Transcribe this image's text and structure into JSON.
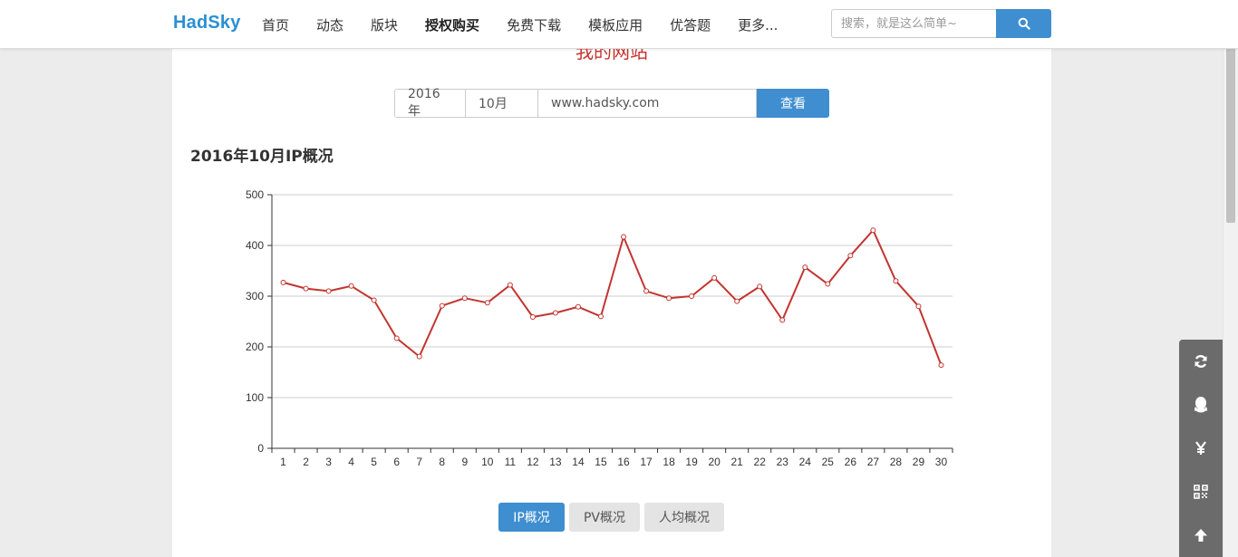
{
  "header": {
    "brand": "HadSky",
    "nav": [
      {
        "label": "首页"
      },
      {
        "label": "动态"
      },
      {
        "label": "版块"
      },
      {
        "label": "授权购买",
        "active": true
      },
      {
        "label": "免费下载"
      },
      {
        "label": "模板应用"
      },
      {
        "label": "优答题"
      },
      {
        "label": "更多..."
      }
    ],
    "search": {
      "placeholder": "搜索，就是这么简单~",
      "button_icon": "search-icon"
    }
  },
  "page": {
    "site_title": "我的网站",
    "filter": {
      "year": "2016年",
      "month": "10月",
      "domain": "www.hadsky.com",
      "query_label": "查看"
    },
    "section_title": "2016年10月IP概况",
    "tabs": [
      {
        "label": "IP概况",
        "active": true
      },
      {
        "label": "PV概况",
        "active": false
      },
      {
        "label": "人均概况",
        "active": false
      }
    ]
  },
  "float_toolbar": [
    "refresh-icon",
    "qq-icon",
    "yen-icon",
    "qrcode-icon",
    "arrow-up-icon"
  ],
  "colors": {
    "brand": "#2a8fd4",
    "accent": "#3e8ed0",
    "line": "#c23531",
    "site_title": "#c9302c"
  },
  "chart_data": {
    "type": "line",
    "title": "2016年10月IP概况",
    "xlabel": "",
    "ylabel": "",
    "x": [
      "1",
      "2",
      "3",
      "4",
      "5",
      "6",
      "7",
      "8",
      "9",
      "10",
      "11",
      "12",
      "13",
      "14",
      "15",
      "16",
      "17",
      "18",
      "19",
      "20",
      "21",
      "22",
      "23",
      "24",
      "25",
      "26",
      "27",
      "28",
      "29",
      "30"
    ],
    "series": [
      {
        "values": [
          327,
          315,
          310,
          320,
          292,
          217,
          181,
          281,
          296,
          287,
          322,
          259,
          267,
          279,
          260,
          417,
          310,
          296,
          300,
          336,
          290,
          319,
          253,
          357,
          324,
          380,
          430,
          330,
          280,
          164
        ]
      }
    ],
    "ylim": [
      0,
      500
    ],
    "yticks": [
      0,
      100,
      200,
      300,
      400,
      500
    ],
    "grid": true,
    "legend": "none"
  }
}
